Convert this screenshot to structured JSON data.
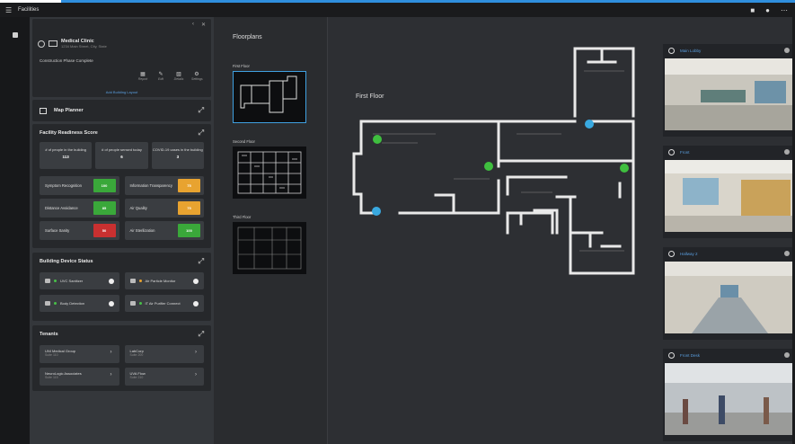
{
  "app": {
    "title": "Facilities"
  },
  "building": {
    "name": "Medical Clinic",
    "address": "1234 Main Street, City, State",
    "description": "Construction Phase Complete",
    "actions": [
      {
        "label": "Report",
        "icon": "report-icon"
      },
      {
        "label": "Edit",
        "icon": "edit-icon"
      },
      {
        "label": "Details",
        "icon": "details-icon"
      },
      {
        "label": "Settings",
        "icon": "settings-icon"
      }
    ],
    "link": "Add Building Layout"
  },
  "map_planner": {
    "label": "Map Planner"
  },
  "readiness": {
    "title": "Facility Readiness Score",
    "tiles": [
      {
        "label": "# of people in the building",
        "value": "113"
      },
      {
        "label": "# of people sensed today",
        "value": "6"
      },
      {
        "label": "COVID-19 cases in the building",
        "value": "3"
      }
    ],
    "rows": [
      {
        "label": "Symptom Recognition",
        "value": "100",
        "status": "green"
      },
      {
        "label": "Information Transparency",
        "value": "75",
        "status": "amber"
      },
      {
        "label": "Distance Avoidance",
        "value": "85",
        "status": "green"
      },
      {
        "label": "Air Quality",
        "value": "75",
        "status": "amber"
      },
      {
        "label": "Surface Sanity",
        "value": "50",
        "status": "red"
      },
      {
        "label": "Air Sterilization",
        "value": "100",
        "status": "green"
      }
    ]
  },
  "devices": {
    "title": "Building Device Status",
    "items": [
      {
        "label": "UVC Sanitizer",
        "icon": "uvc-icon",
        "state": "green"
      },
      {
        "label": "Air Particle Monitor",
        "icon": "air-monitor-icon",
        "state": "amber"
      },
      {
        "label": "Body Detection",
        "icon": "body-detection-icon",
        "state": "green"
      },
      {
        "label": "IT Air Purifier Connect",
        "icon": "purifier-icon",
        "state": "green"
      }
    ]
  },
  "tenants": {
    "title": "Tenants",
    "items": [
      {
        "name": "UNI Medical Group",
        "sub": "Suite 110"
      },
      {
        "name": "LabCorp",
        "sub": "Suite 200"
      },
      {
        "name": "NeuroLogic Associates",
        "sub": "Suite 115"
      },
      {
        "name": "UVA Flow",
        "sub": "Suite 210"
      }
    ]
  },
  "floorplans": {
    "title": "Floorplans",
    "floors": [
      {
        "label": "First Floor"
      },
      {
        "label": "Second Floor"
      },
      {
        "label": "Third Floor"
      }
    ]
  },
  "map": {
    "floor_label": "First Floor",
    "colors": {
      "camera": "#39a9e0",
      "sensor": "#3fbf3f",
      "wall": "#e9e9e9"
    }
  },
  "cameras": [
    {
      "name": "Main Lobby"
    },
    {
      "name": "Front"
    },
    {
      "name": "Hallway 2"
    },
    {
      "name": "Front Desk"
    }
  ]
}
